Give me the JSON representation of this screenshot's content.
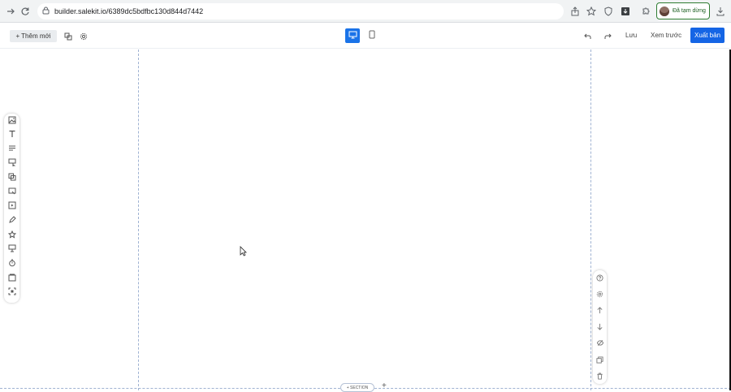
{
  "browser": {
    "url": "builder.salekit.io/6389dc5bdfbc130d844d7442",
    "profile_label": "Đã tạm dừng"
  },
  "toolbar": {
    "add_new_label": "Thêm mới",
    "save_label": "Lưu",
    "preview_label": "Xem trước",
    "publish_label": "Xuất bản",
    "active_device": "desktop"
  },
  "left_panel": {
    "items": [
      "image",
      "text",
      "paragraph",
      "form",
      "group",
      "popup",
      "video",
      "shape",
      "star",
      "slider",
      "timer",
      "gallery",
      "frame"
    ]
  },
  "right_panel": {
    "items": [
      "help",
      "settings",
      "move-up",
      "move-down",
      "hide",
      "duplicate",
      "delete"
    ]
  },
  "section": {
    "pill_label": "+ SECTION"
  },
  "colors": {
    "accent": "#1a73e8",
    "publish": "#1565e5",
    "guide": "#9fb2d2"
  }
}
